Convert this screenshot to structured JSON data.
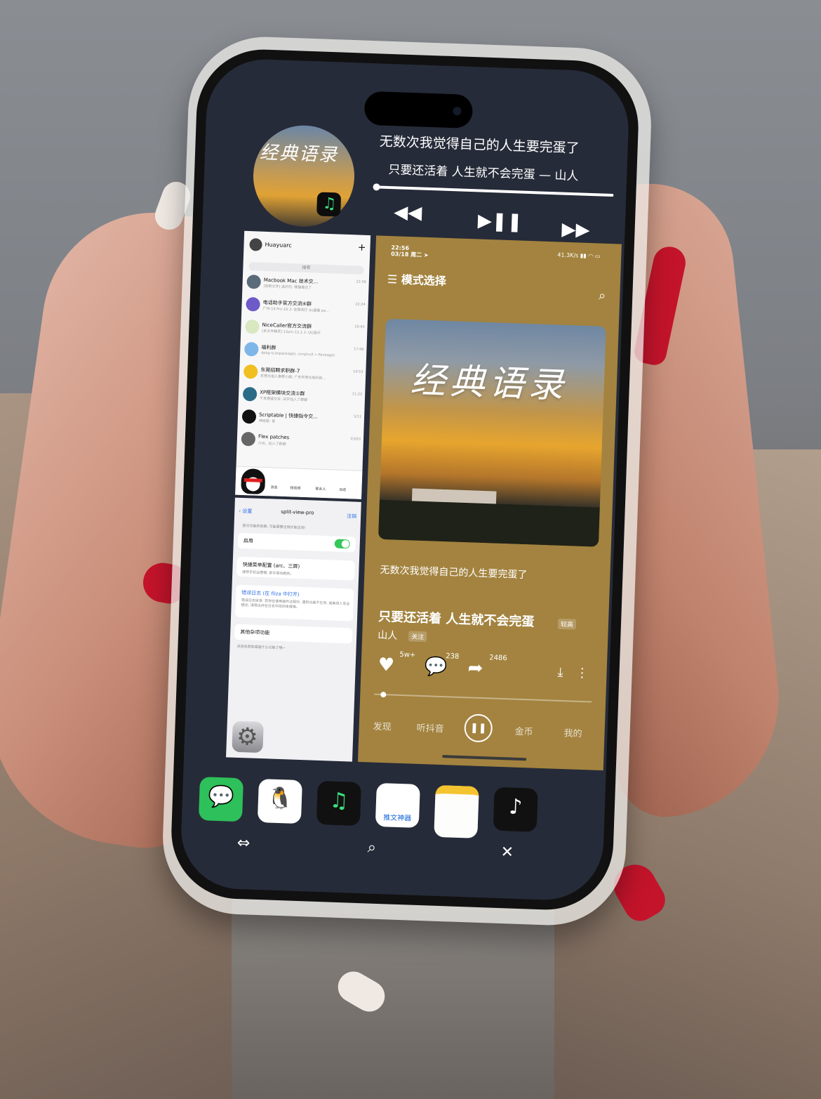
{
  "widget": {
    "cover_title": "经典语录",
    "lyric_line1": "无数次我觉得自己的人生要完蛋了",
    "lyric_line2": "只要还活着 人生就不会完蛋 — 山人",
    "prev_icon": "rewind-icon",
    "playpause_icon": "play-pause-icon",
    "next_icon": "fast-forward-icon"
  },
  "chat": {
    "user": "Huayuarc",
    "search_placeholder": "搜索",
    "rows": [
      {
        "title": "Macbook Mac 技术交...",
        "sub": "[有新文件] 追问元: 哪猫看还了",
        "time": "22:58",
        "color": "#5b6b7a"
      },
      {
        "title": "电话助手官方交流④群",
        "sub": "广州-14 Pro-16.3: 在微信打 du盛看 pe...",
        "time": "22:24",
        "color": "#6e5ac8"
      },
      {
        "title": "NiceCaller官方交流群",
        "sub": "[多文件精灵] 12pm-15.1.1: QQ音乐",
        "time": "19:43",
        "color": "#d8e8c0"
      },
      {
        "title": "福利群",
        "sub": "dpkg-scanpackages ./cmj/null > Packages",
        "time": "17:46",
        "color": "#7eb6e8"
      },
      {
        "title": "东莞招聘求职群-7",
        "sub": "东莞光电人事群小能: 广东东莞光电科技...",
        "time": "14:53",
        "color": "#f0c020"
      },
      {
        "title": "XP框架模块交流①群",
        "sub": "千发通道交互: 白乎加入了群聊",
        "time": "11:22",
        "color": "#2a6b88"
      },
      {
        "title": "Scriptable | 快捷指令交...",
        "sub": "神经极: 哥",
        "time": "5/11",
        "color": "#111111"
      },
      {
        "title": "Flex patches",
        "sub": "六月。加入了群聊",
        "time": "03/03",
        "color": "#666666"
      }
    ],
    "tabs": [
      "消息",
      "短视频",
      "联系人",
      "动态"
    ]
  },
  "settings": {
    "back": "设置",
    "title": "split-view-pro",
    "logout": "注销",
    "note": "部分功能的依赖, 可能需要注销才能生效!",
    "enable_label": "启用",
    "menu_label": "快捷菜单配置 (arc、三屏)",
    "menu_sub": "顺带手机设置模, 即手驱动跑的。",
    "log_label": "错误日志 (在 filza 中打开)",
    "log_sub": "错误日志目录: 若你在使用插件过程中, 遇到功能不生效, 或者进入安全模式, 请导出并在日志中找到本报错。",
    "misc_label": "其他杂项功能",
    "footer": "点进去就知道是什么功能了哦~"
  },
  "music": {
    "time": "22:56",
    "date": "03/18 周二",
    "net": "41.3K/s",
    "mode_title": "模式选择",
    "album_title": "经典语录",
    "lyric1": "无数次我觉得自己的人生要完蛋了",
    "lyric2": "只要还活着 人生就不会完蛋",
    "quality": "较高",
    "artist": "山人",
    "follow": "关注",
    "likes": "5w+",
    "comments": "238",
    "shares": "2486",
    "progress": 0.03,
    "nav": [
      "发现",
      "听抖音",
      "金币",
      "我的"
    ]
  },
  "dock": [
    {
      "name": "wechat-app",
      "bg": "#2ec05a",
      "glyph": "💬"
    },
    {
      "name": "qq-app",
      "bg": "#ffffff",
      "glyph": "🐧"
    },
    {
      "name": "qishui-music-app",
      "bg": "#111111",
      "glyph": "♫"
    },
    {
      "name": "tuiwen-app",
      "bg": "#ffffff",
      "glyph": "推文神器"
    },
    {
      "name": "notes-app",
      "bg": "#fdfdfb",
      "glyph": ""
    },
    {
      "name": "douyin-app",
      "bg": "#111111",
      "glyph": "♪"
    }
  ],
  "bottom_bar": {
    "swap_icon": "swap-icon",
    "search_icon": "search-icon",
    "close_icon": "close-icon"
  }
}
